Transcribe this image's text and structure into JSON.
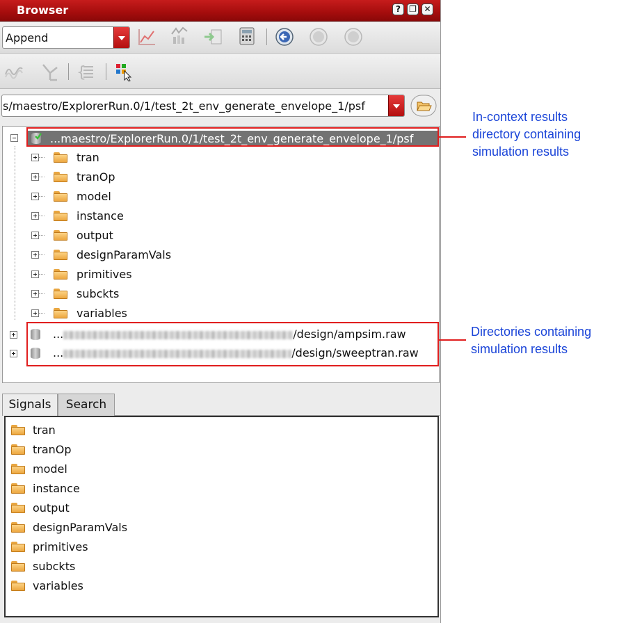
{
  "window": {
    "title": "Browser",
    "help_icon": "?",
    "restore_icon": "❐",
    "close_icon": "✕"
  },
  "toolbar": {
    "mode_value": "Append",
    "icons_row1": [
      "plot-icon",
      "multi-plot-icon",
      "import-icon",
      "calculator-icon",
      "back-icon",
      "forward-icon",
      "up-icon"
    ],
    "icons_row2": [
      "waveform-icon",
      "signal-icon",
      "expression-icon",
      "grid-select-icon"
    ]
  },
  "path": {
    "value": "s/maestro/ExplorerRun.0/1/test_2t_env_generate_envelope_1/psf"
  },
  "tree": {
    "root": {
      "label": "...maestro/ExplorerRun.0/1/test_2t_env_generate_envelope_1/psf"
    },
    "children": [
      "tran",
      "tranOp",
      "model",
      "instance",
      "output",
      "designParamVals",
      "primitives",
      "subckts",
      "variables"
    ],
    "others": [
      {
        "prefix": "...",
        "suffix": "/design/ampsim.raw"
      },
      {
        "prefix": "...",
        "suffix": "/design/sweeptran.raw"
      }
    ]
  },
  "tabs": [
    {
      "label": "Signals",
      "active": true
    },
    {
      "label": "Search",
      "active": false
    }
  ],
  "signals": [
    "tran",
    "tranOp",
    "model",
    "instance",
    "output",
    "designParamVals",
    "primitives",
    "subckts",
    "variables"
  ],
  "annotations": {
    "incontext": [
      "In-context results",
      "directory containing",
      "simulation results"
    ],
    "dirs": [
      "Directories containing",
      "simulation results"
    ]
  },
  "colors": {
    "titlebar": "#b01414",
    "highlight": "#737373",
    "callout": "#1a44d8",
    "annotation_box": "#e01e1e"
  }
}
